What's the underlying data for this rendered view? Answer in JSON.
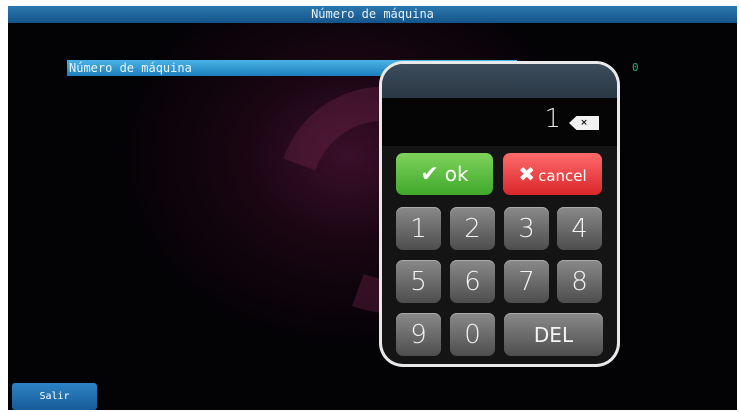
{
  "window": {
    "title": "Número de máquina"
  },
  "field": {
    "label": "Número de máquina",
    "value": "0"
  },
  "footer": {
    "exit_label": "Salir"
  },
  "keypad": {
    "display_value": "1",
    "backspace_label": "×",
    "ok_icon": "✔",
    "ok_label": "ok",
    "cancel_icon": "✖",
    "cancel_label": "cancel",
    "keys": [
      "1",
      "2",
      "3",
      "4",
      "5",
      "6",
      "7",
      "8",
      "9",
      "0"
    ],
    "del_label": "DEL"
  },
  "colors": {
    "title_bar": "#15548a",
    "field_highlight": "#4ab3e6",
    "value_text": "#2cae6a",
    "ok": "#3fa82b",
    "cancel": "#d9262a"
  }
}
